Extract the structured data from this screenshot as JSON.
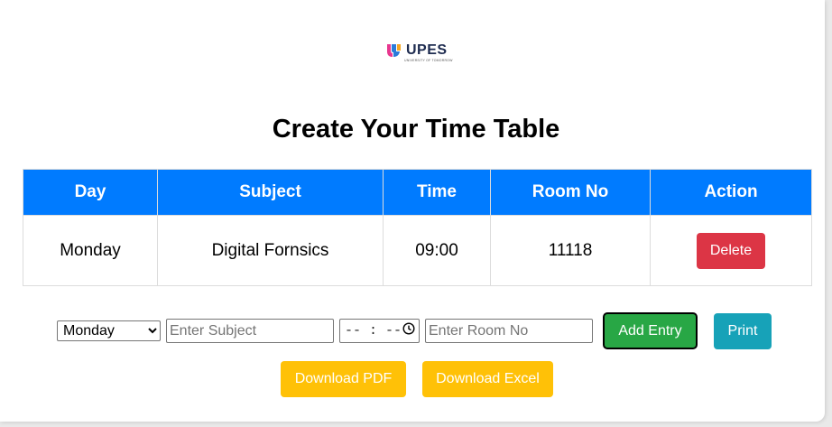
{
  "logo": {
    "text": "UPES",
    "subtext": "UNIVERSITY OF TOMORROW"
  },
  "page_title": "Create Your Time Table",
  "table": {
    "headers": [
      "Day",
      "Subject",
      "Time",
      "Room No",
      "Action"
    ],
    "rows": [
      {
        "day": "Monday",
        "subject": "Digital Fornsics",
        "time": "09:00",
        "room": "11118",
        "action": "Delete"
      }
    ]
  },
  "form": {
    "day_selected": "Monday",
    "subject_placeholder": "Enter Subject",
    "time_display": "-- : --",
    "room_placeholder": "Enter Room No",
    "add_label": "Add Entry",
    "print_label": "Print",
    "pdf_label": "Download PDF",
    "excel_label": "Download Excel"
  },
  "colors": {
    "header_bg": "#007bff",
    "delete": "#dc3545",
    "add": "#28a745",
    "print": "#17a2b8",
    "download": "#ffc107"
  },
  "icons": {
    "time_picker": "clock-icon",
    "select_arrow": "chevron-down-icon"
  }
}
